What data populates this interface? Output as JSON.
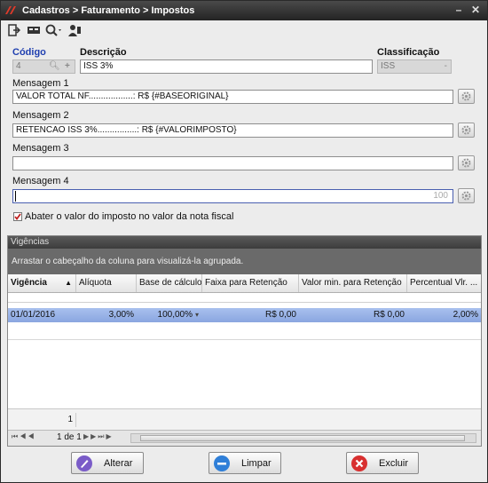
{
  "window": {
    "title": "Cadastros > Faturamento > Impostos"
  },
  "form": {
    "codigo_label": "Código",
    "codigo_value": "4",
    "descricao_label": "Descrição",
    "descricao_value": "ISS 3%",
    "classificacao_label": "Classificação",
    "classificacao_value": "ISS",
    "mensagem1_label": "Mensagem 1",
    "mensagem1_value": "VALOR TOTAL NF..................: R$ {#BASEORIGINAL}",
    "mensagem2_label": "Mensagem 2",
    "mensagem2_value": "RETENCAO ISS 3%................: R$ {#VALORIMPOSTO}",
    "mensagem3_label": "Mensagem 3",
    "mensagem3_value": "",
    "mensagem4_label": "Mensagem 4",
    "mensagem4_value": "",
    "mensagem4_counter": "100",
    "abater_label": "Abater o valor do imposto no valor da nota fiscal",
    "abater_checked": true
  },
  "vigencias": {
    "title": "Vigências",
    "group_hint": "Arrastar o cabeçalho da coluna para visualizá-la agrupada.",
    "columns": [
      "Vigência",
      "Alíquota",
      "Base de cálculo",
      "Faixa para Retenção",
      "Valor min. para Retenção",
      "Percentual Vlr. ..."
    ],
    "rows": [
      {
        "vigencia": "01/01/2016",
        "aliquota": "3,00%",
        "base": "100,00%",
        "faixa": "R$ 0,00",
        "valor_min": "R$ 0,00",
        "percentual": "2,00%"
      }
    ],
    "footer_count": "1",
    "pager_text": "1 de 1"
  },
  "buttons": {
    "alterar": "Alterar",
    "limpar": "Limpar",
    "excluir": "Excluir"
  },
  "colors": {
    "selected_row": "#8aa6e0",
    "title_bar": "#2a2a2a",
    "accent_blue": "#1f3fb0"
  }
}
